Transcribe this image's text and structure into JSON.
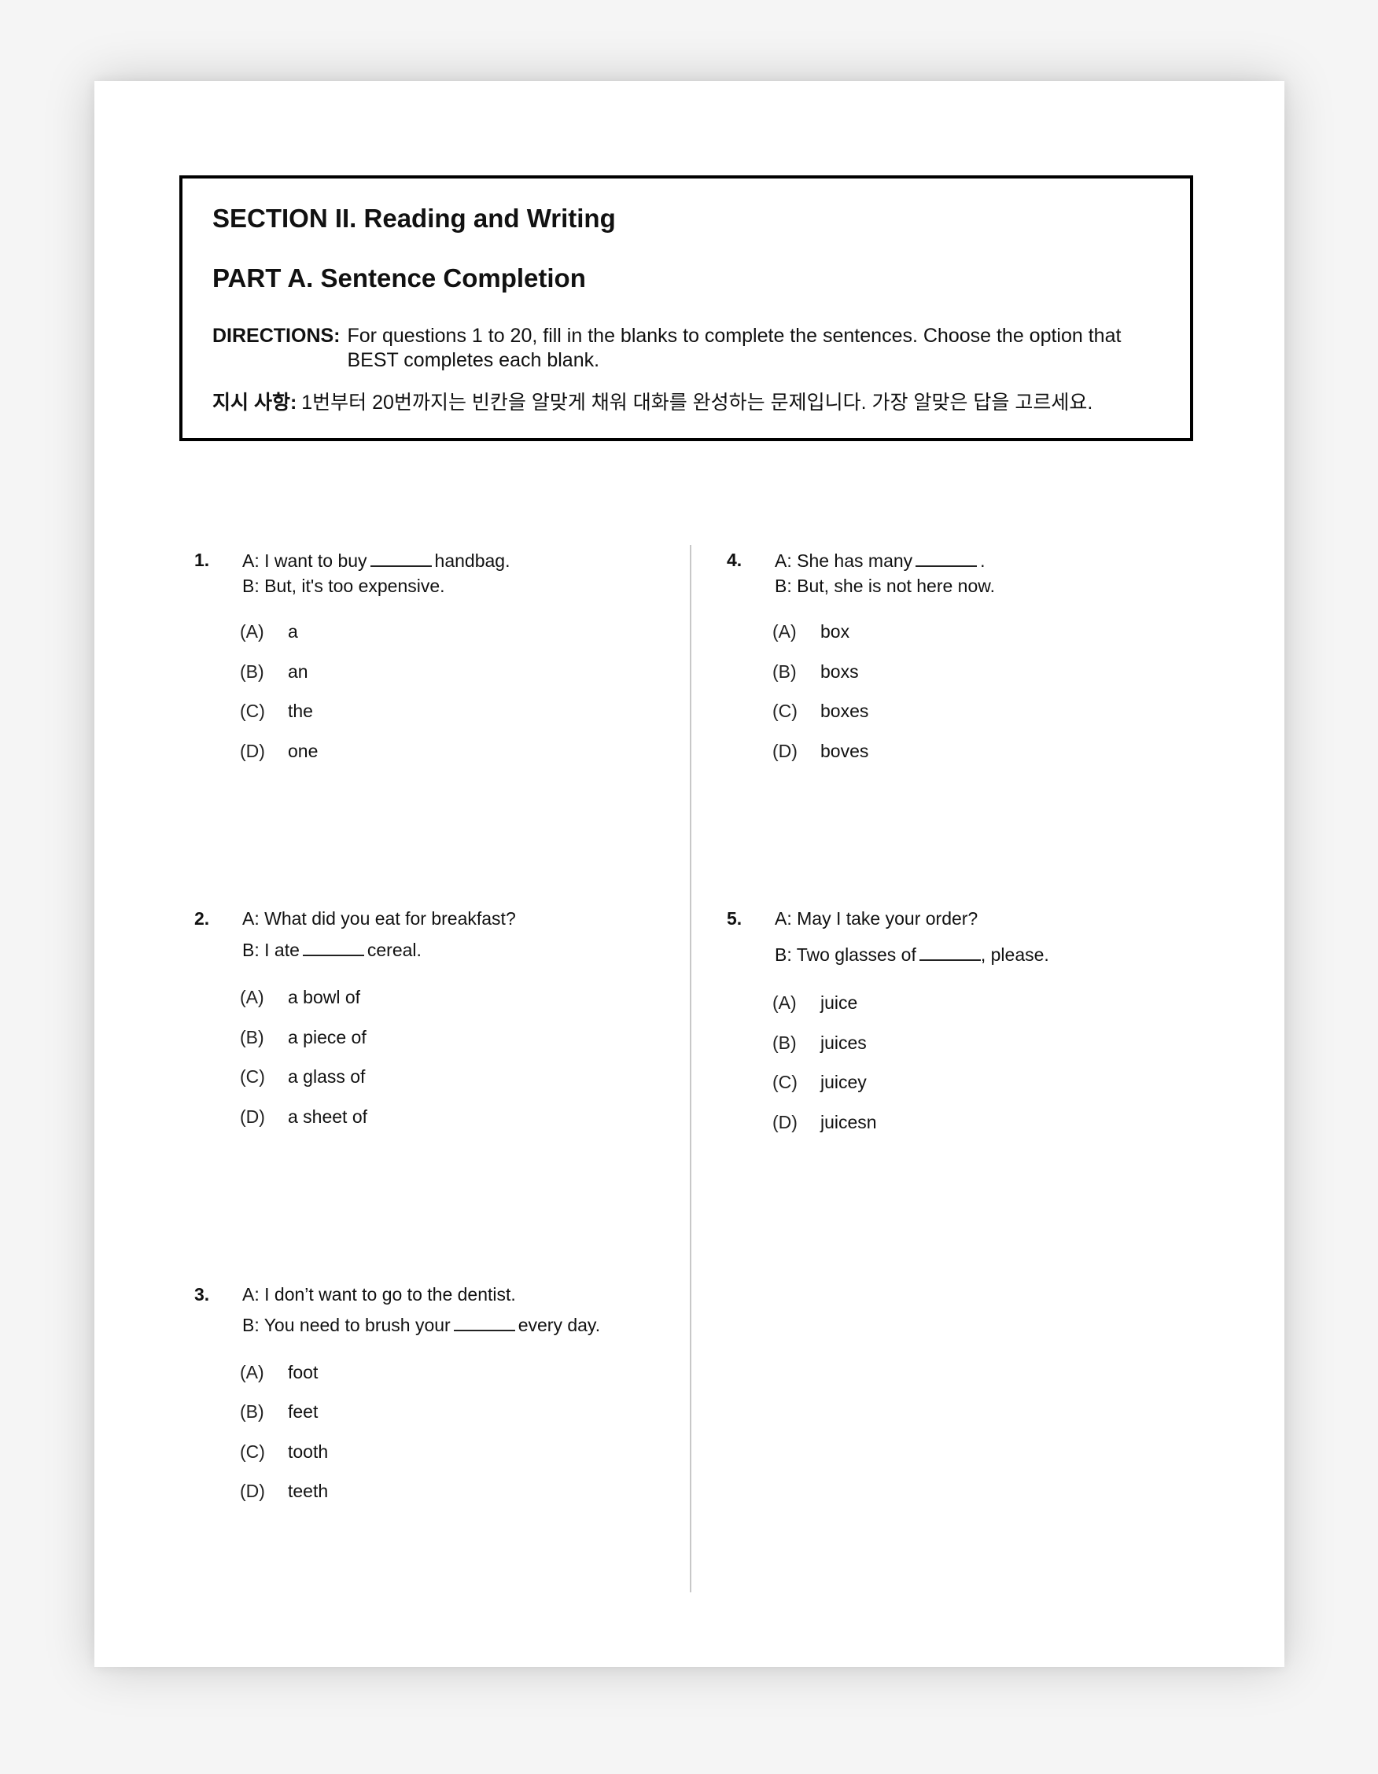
{
  "header": {
    "section_title": "SECTION II. Reading and Writing",
    "part_title": "PART A. Sentence Completion",
    "directions_label": "DIRECTIONS:",
    "directions_text": "For questions 1 to 20, fill in the blanks to complete the sentences. Choose the option that BEST completes each blank.",
    "korean_label": "지시 사항:",
    "korean_text": "1번부터 20번까지는 빈칸을 알맞게 채워 대화를 완성하는 문제입니다. 가장 알맞은 답을 고르세요."
  },
  "questions": [
    {
      "number": "1.",
      "a_pre": "A: I want to buy",
      "a_post": "handbag.",
      "b_line": "B: But, it's too expensive.",
      "options": [
        {
          "letter": "(A)",
          "text": "a"
        },
        {
          "letter": "(B)",
          "text": "an"
        },
        {
          "letter": "(C)",
          "text": "the"
        },
        {
          "letter": "(D)",
          "text": "one"
        }
      ]
    },
    {
      "number": "2.",
      "a_line": "A: What did you eat for breakfast?",
      "b_pre": "B: I ate",
      "b_post": "cereal.",
      "options": [
        {
          "letter": "(A)",
          "text": "a bowl of"
        },
        {
          "letter": "(B)",
          "text": "a piece of"
        },
        {
          "letter": "(C)",
          "text": "a glass of"
        },
        {
          "letter": "(D)",
          "text": "a sheet of"
        }
      ]
    },
    {
      "number": "3.",
      "a_line": "A: I don’t want to go to the dentist.",
      "b_pre": "B: You need to brush your",
      "b_post": "every day.",
      "options": [
        {
          "letter": "(A)",
          "text": "foot"
        },
        {
          "letter": "(B)",
          "text": "feet"
        },
        {
          "letter": "(C)",
          "text": "tooth"
        },
        {
          "letter": "(D)",
          "text": "teeth"
        }
      ]
    },
    {
      "number": "4.",
      "a_pre": "A: She has many",
      "a_post": ".",
      "b_line": "B: But, she is not here now.",
      "options": [
        {
          "letter": "(A)",
          "text": "box"
        },
        {
          "letter": "(B)",
          "text": "boxs"
        },
        {
          "letter": "(C)",
          "text": "boxes"
        },
        {
          "letter": "(D)",
          "text": "boves"
        }
      ]
    },
    {
      "number": "5.",
      "a_line": "A: May I take your order?",
      "b_pre": "B: Two glasses of",
      "b_post": ", please.",
      "options": [
        {
          "letter": "(A)",
          "text": "juice"
        },
        {
          "letter": "(B)",
          "text": "juices"
        },
        {
          "letter": "(C)",
          "text": "juicey"
        },
        {
          "letter": "(D)",
          "text": "juicesn"
        }
      ]
    }
  ]
}
